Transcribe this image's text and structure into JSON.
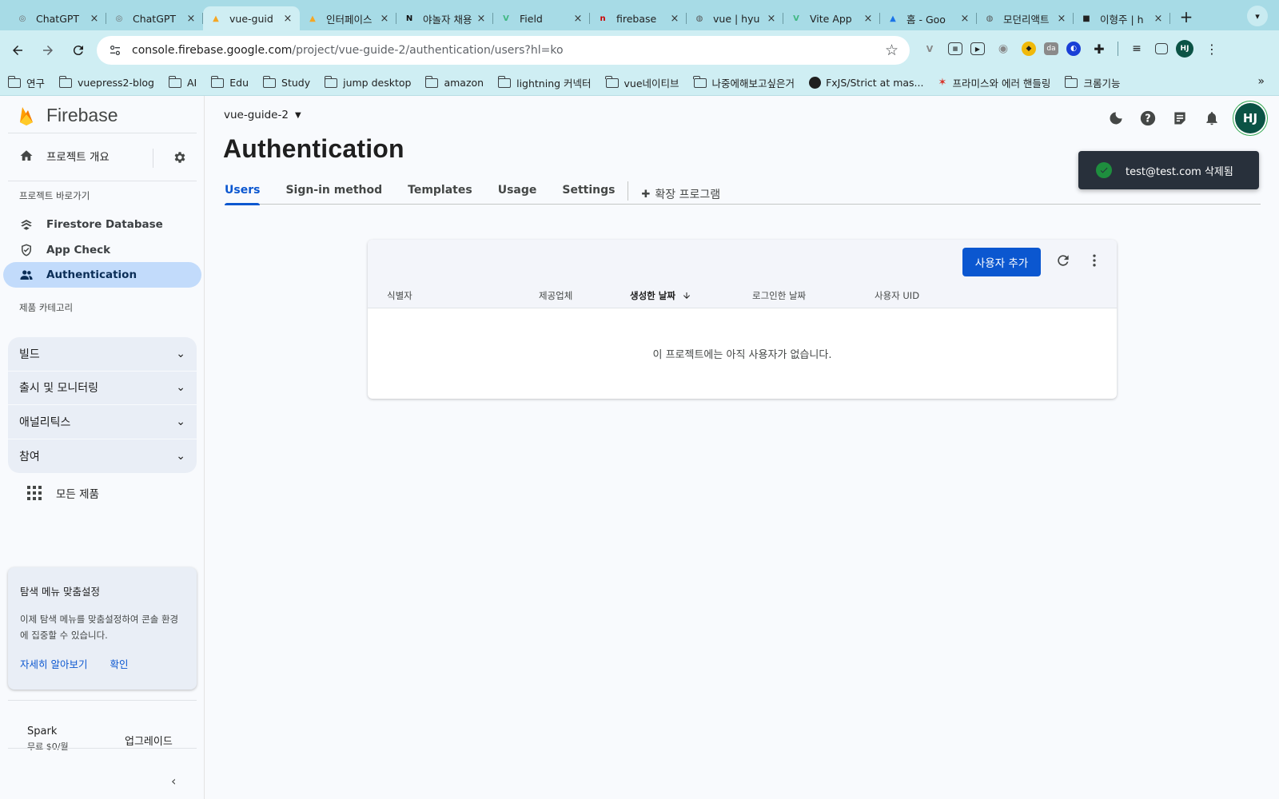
{
  "browser": {
    "tabs": [
      {
        "title": "ChatGPT",
        "icon": "chatgpt-icon",
        "color": "#6b6b6b",
        "glyph": "◎",
        "active": false
      },
      {
        "title": "ChatGPT",
        "icon": "chatgpt-icon",
        "color": "#6b6b6b",
        "glyph": "◎",
        "active": false
      },
      {
        "title": "vue-guid",
        "icon": "firebase-icon",
        "color": "#f5a623",
        "glyph": "▲",
        "active": true
      },
      {
        "title": "인터페이스",
        "icon": "firebase-icon",
        "color": "#f5a623",
        "glyph": "▲",
        "active": false
      },
      {
        "title": "야놀자 채용",
        "icon": "notion-icon",
        "color": "#111111",
        "glyph": "N",
        "active": false
      },
      {
        "title": "Field",
        "icon": "vue-icon",
        "color": "#41b883",
        "glyph": "V",
        "active": false
      },
      {
        "title": "firebase",
        "icon": "npm-icon",
        "color": "#cb0000",
        "glyph": "n",
        "active": false
      },
      {
        "title": "vue | hyu",
        "icon": "globe-icon",
        "color": "#555555",
        "glyph": "◍",
        "active": false
      },
      {
        "title": "Vite App",
        "icon": "vue-icon",
        "color": "#41b883",
        "glyph": "V",
        "active": false
      },
      {
        "title": "홈 - Goo",
        "icon": "drive-icon",
        "color": "#1a73e8",
        "glyph": "▲",
        "active": false
      },
      {
        "title": "모던리액트",
        "icon": "globe-icon",
        "color": "#555555",
        "glyph": "◍",
        "active": false
      },
      {
        "title": "이형주 | h",
        "icon": "photo-icon",
        "color": "#222222",
        "glyph": "■",
        "active": false
      }
    ],
    "url_host": "console.firebase.google.com",
    "url_path": "/project/vue-guide-2/authentication/users?hl=ko",
    "profile_initials": "HJ",
    "bookmarks": [
      {
        "label": "연구",
        "icon": "folder-icon"
      },
      {
        "label": "vuepress2-blog",
        "icon": "folder-icon"
      },
      {
        "label": "AI",
        "icon": "folder-icon"
      },
      {
        "label": "Edu",
        "icon": "folder-icon"
      },
      {
        "label": "Study",
        "icon": "folder-icon"
      },
      {
        "label": "jump desktop",
        "icon": "folder-icon"
      },
      {
        "label": "amazon",
        "icon": "folder-icon"
      },
      {
        "label": "lightning 커넥터",
        "icon": "folder-icon"
      },
      {
        "label": "vue네이티브",
        "icon": "folder-icon"
      },
      {
        "label": "나중에해보고싶은거",
        "icon": "folder-icon"
      },
      {
        "label": "FxJS/Strict at mas...",
        "icon": "github-icon"
      },
      {
        "label": "프라미스와 에러 핸들링",
        "icon": "promise-icon"
      },
      {
        "label": "크롬기능",
        "icon": "folder-icon"
      }
    ]
  },
  "sidebar": {
    "brand": "Firebase",
    "overview": "프로젝트 개요",
    "shortcuts_label": "프로젝트 바로가기",
    "shortcuts": [
      {
        "label": "Firestore Database",
        "icon": "firestore-icon"
      },
      {
        "label": "App Check",
        "icon": "shield-check-icon"
      },
      {
        "label": "Authentication",
        "icon": "people-icon",
        "active": true
      }
    ],
    "categories_label": "제품 카테고리",
    "categories": [
      "빌드",
      "출시 및 모니터링",
      "애널리틱스",
      "참여"
    ],
    "all_products": "모든 제품",
    "promo": {
      "title": "탐색 메뉴 맞춤설정",
      "body": "이제 탐색 메뉴를 맞춤설정하여 콘솔 환경에 집중할 수 있습니다.",
      "learn_more": "자세히 알아보기",
      "confirm": "확인"
    },
    "plan": {
      "name": "Spark",
      "price": "무료 $0/월",
      "upgrade": "업그레이드"
    }
  },
  "main": {
    "project": "vue-guide-2",
    "title": "Authentication",
    "tabs": [
      {
        "label": "Users",
        "active": true
      },
      {
        "label": "Sign-in method"
      },
      {
        "label": "Templates"
      },
      {
        "label": "Usage"
      },
      {
        "label": "Settings"
      }
    ],
    "extensions_tab": "확장 프로그램",
    "avatar_initials": "HJ",
    "toast": "test@test.com 삭제됨",
    "table": {
      "add_user": "사용자 추가",
      "columns": [
        "식별자",
        "제공업체",
        "생성한 날짜",
        "로그인한 날짜",
        "사용자 UID"
      ],
      "sorted_column": "생성한 날짜",
      "empty_message": "이 프로젝트에는 아직 사용자가 없습니다."
    }
  },
  "colors": {
    "accent": "#0b57d0",
    "active_nav": "#c2dbfb",
    "toast_bg": "#28303b",
    "success": "#1e8e3e"
  }
}
